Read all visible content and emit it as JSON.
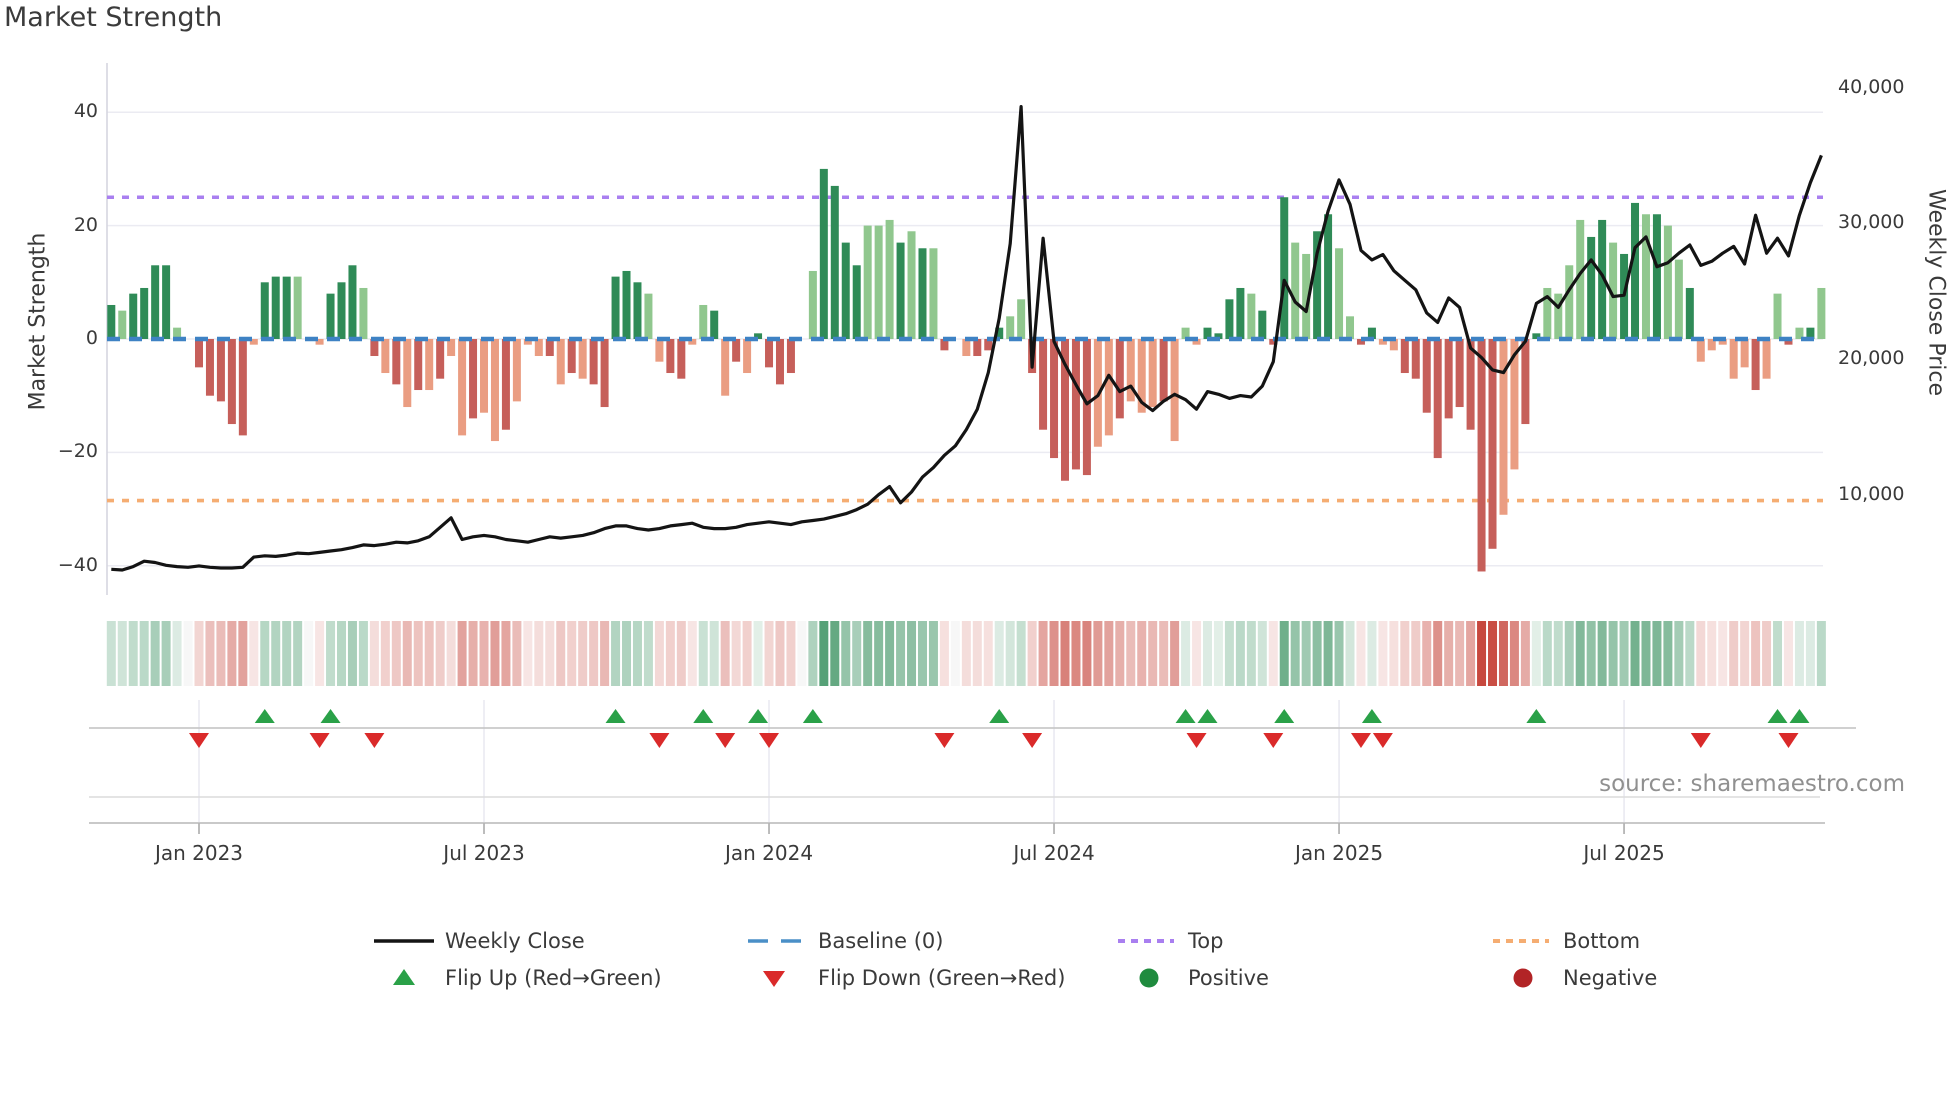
{
  "title": "Market Strength",
  "source": "source: sharemaestro.com",
  "axes": {
    "left": {
      "label": "Market Strength",
      "tick_labels": [
        "40",
        "20",
        "0",
        "−20",
        "−40"
      ],
      "tick_values": [
        40,
        20,
        0,
        -20,
        -40
      ]
    },
    "right": {
      "label": "Weekly Close Price",
      "tick_labels": [
        "40,000",
        "30,000",
        "20,000",
        "10,000"
      ],
      "tick_values": [
        40000,
        30000,
        20000,
        10000
      ]
    },
    "x": {
      "tick_labels": [
        "Jan 2023",
        "Jul 2023",
        "Jan 2024",
        "Jul 2024",
        "Jan 2025",
        "Jul 2025"
      ],
      "tick_weeks": [
        8,
        34,
        60,
        86,
        112,
        138
      ]
    }
  },
  "legend": {
    "row1": [
      {
        "icon": "line-swatch",
        "label": "Weekly Close"
      },
      {
        "icon": "dashed-swatch",
        "label": "Baseline (0)"
      },
      {
        "icon": "dotted-swatch-purple",
        "label": "Top"
      },
      {
        "icon": "dotted-swatch-orange",
        "label": "Bottom"
      }
    ],
    "row2": [
      {
        "icon": "triangle-up",
        "label": "Flip Up (Red→Green)"
      },
      {
        "icon": "triangle-down",
        "label": "Flip Down (Green→Red)"
      },
      {
        "icon": "circle-green",
        "label": "Positive"
      },
      {
        "icon": "circle-red",
        "label": "Negative"
      }
    ]
  },
  "colors": {
    "bar_positive_dark": "#2f8b57",
    "bar_positive_light": "#90c78e",
    "bar_negative_dark": "#c65f5a",
    "bar_negative_light": "#ea9d82",
    "price_line": "#141414",
    "baseline": "#3e82c4",
    "top_line": "#a97ff0",
    "bottom_line": "#f5ad72",
    "flip_up": "#2aa148",
    "flip_down": "#da2a2a",
    "legend_positive_dot": "#1f8b3e",
    "legend_negative_dot": "#b22426",
    "grid": "#ebebf2",
    "spine": "#d4d4de",
    "axis_line": "#c9c9c9"
  },
  "chart_data": {
    "type": "bar",
    "title": "Market Strength",
    "x_unit": "week",
    "n_weeks": 157,
    "ylim_left": [
      -45,
      48
    ],
    "grid": "horizontal",
    "legend_position": "bottom",
    "baseline": 0,
    "top_line": 25,
    "bottom_line": -28.5,
    "series": [
      {
        "name": "Market Strength",
        "type": "bar",
        "axis": "left",
        "values": [
          6,
          5,
          8,
          9,
          13,
          13,
          2,
          0,
          -5,
          -10,
          -11,
          -15,
          -17,
          -1,
          10,
          11,
          11,
          11,
          0,
          -1,
          8,
          10,
          13,
          9,
          -3,
          -6,
          -8,
          -12,
          -9,
          -9,
          -7,
          -3,
          -17,
          -14,
          -13,
          -18,
          -16,
          -11,
          -1,
          -3,
          -3,
          -8,
          -6,
          -7,
          -8,
          -12,
          11,
          12,
          10,
          8,
          -4,
          -6,
          -7,
          -1,
          6,
          5,
          -10,
          -4,
          -6,
          1,
          -5,
          -8,
          -6,
          0,
          12,
          30,
          27,
          17,
          13,
          20,
          20,
          21,
          17,
          19,
          16,
          16,
          -2,
          0,
          -3,
          -3,
          -2,
          2,
          4,
          7,
          -6,
          -16,
          -21,
          -25,
          -23,
          -24,
          -19,
          -17,
          -14,
          -11,
          -13,
          -12,
          -11,
          -18,
          2,
          -1,
          2,
          1,
          7,
          9,
          8,
          5,
          -1,
          25,
          17,
          15,
          19,
          22,
          16,
          4,
          -1,
          2,
          -1,
          -2,
          -6,
          -7,
          -13,
          -21,
          -14,
          -12,
          -16,
          -41,
          -37,
          -31,
          -23,
          -15,
          1,
          9,
          8,
          13,
          21,
          18,
          21,
          17,
          15,
          24,
          22,
          22,
          20,
          14,
          9,
          -4,
          -2,
          -1,
          -7,
          -5,
          -9,
          -7,
          8,
          -1,
          2,
          2,
          9
        ]
      },
      {
        "name": "Weekly Close",
        "type": "line",
        "axis": "right",
        "values": [
          4500,
          4450,
          4700,
          5100,
          5000,
          4800,
          4700,
          4650,
          4750,
          4650,
          4600,
          4600,
          4650,
          5400,
          5500,
          5450,
          5550,
          5700,
          5650,
          5750,
          5850,
          5950,
          6100,
          6300,
          6250,
          6350,
          6500,
          6450,
          6600,
          6900,
          7600,
          8300,
          6700,
          6900,
          7000,
          6900,
          6700,
          6600,
          6500,
          6700,
          6900,
          6800,
          6900,
          7000,
          7200,
          7500,
          7700,
          7700,
          7500,
          7400,
          7500,
          7700,
          7800,
          7900,
          7600,
          7500,
          7500,
          7600,
          7800,
          7900,
          8000,
          7900,
          7800,
          8000,
          8100,
          8200,
          8400,
          8600,
          8900,
          9300,
          10000,
          10600,
          9400,
          10200,
          11300,
          12000,
          12900,
          13600,
          14800,
          16300,
          19000,
          23000,
          28500,
          38600,
          19400,
          28900,
          21300,
          19600,
          18100,
          16700,
          17300,
          18800,
          17600,
          18000,
          16800,
          16200,
          16900,
          17400,
          17000,
          16300,
          17600,
          17400,
          17100,
          17300,
          17200,
          18000,
          19800,
          25800,
          24200,
          23500,
          27800,
          30900,
          33200,
          31400,
          28000,
          27300,
          27700,
          26500,
          25800,
          25100,
          23400,
          22700,
          24500,
          23800,
          20800,
          20100,
          19200,
          19000,
          20300,
          21300,
          24100,
          24600,
          23800,
          25100,
          26300,
          27300,
          26200,
          24600,
          24700,
          28200,
          29000,
          26800,
          27100,
          27800,
          28400,
          26900,
          27200,
          27800,
          28300,
          27000,
          30600,
          27800,
          28900,
          27600,
          30600,
          33000,
          35000
        ]
      }
    ],
    "bar_tones": "dlddddlddddddldddldldddldldldldlldlldllldldldddddllddlldldldddddlddddllldldldlldddllddddddlldllldlllddddldddllddllddlldddddddddllddllllddldd ldlldllllldlldldlddddddd",
    "flip_up_weeks": [
      14,
      20,
      46,
      54,
      59,
      64,
      81,
      98,
      100,
      107,
      115,
      130,
      152,
      154
    ],
    "flip_down_weeks": [
      8,
      19,
      24,
      50,
      56,
      60,
      76,
      84,
      99,
      106,
      114,
      116,
      145,
      153
    ],
    "heatmap": "same weekly values rendered as red/green intensity strip"
  }
}
